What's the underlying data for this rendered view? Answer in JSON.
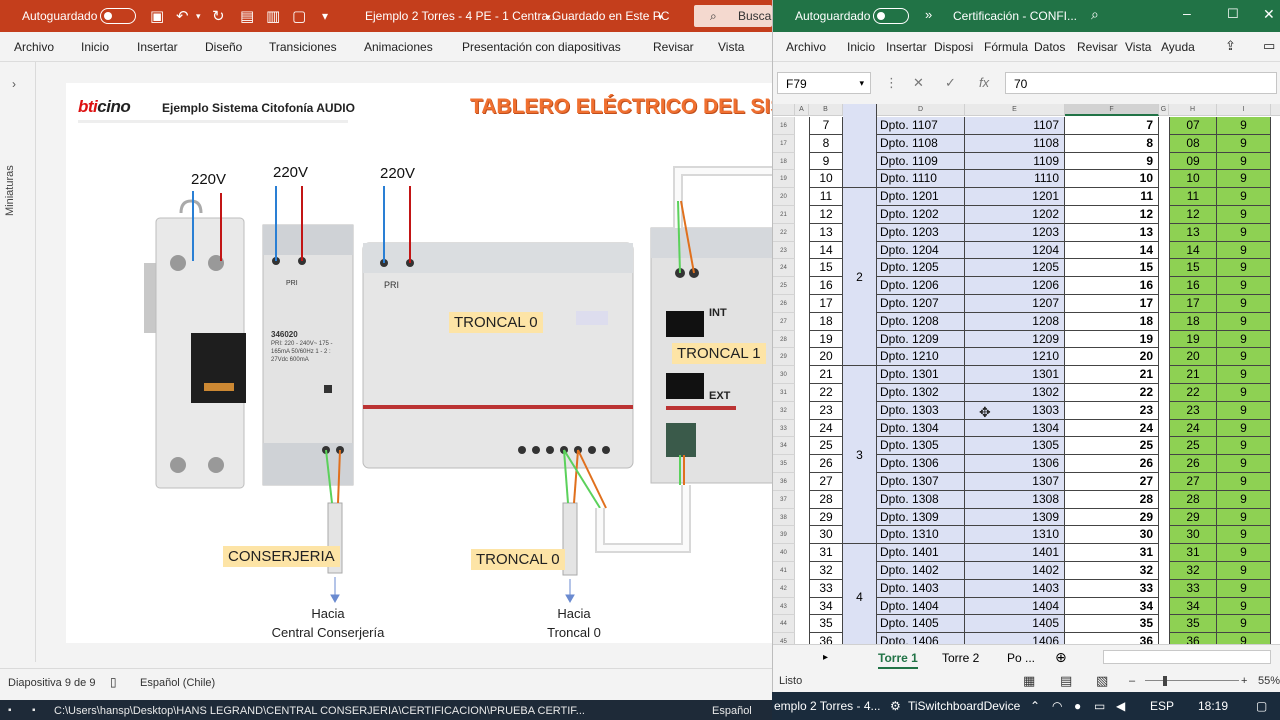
{
  "ppt": {
    "autosave_label": "Autoguardado",
    "doc_title": "Ejemplo 2 Torres - 4 PE - 1 Centra...",
    "save_state": "Guardado en Este PC",
    "search_label": "Buscar",
    "ribbon": [
      "Archivo",
      "Inicio",
      "Insertar",
      "Diseño",
      "Transiciones",
      "Animaciones",
      "Presentación con diapositivas",
      "Revisar",
      "Vista"
    ],
    "thumbs_label": "Miniaturas",
    "status_slide": "Diapositiva 9 de 9",
    "status_lang": "Español (Chile)"
  },
  "slide": {
    "logo_part1": "bti",
    "logo_part2": "cino",
    "subtitle": "Ejemplo Sistema Citofonía AUDIO",
    "title": "TABLERO ELÉCTRICO DEL SISTE",
    "v220": [
      "220V",
      "220V",
      "220V"
    ],
    "psu_model": "346020",
    "psu_text": "PRI: 220 - 240V~ 175 - 165mA 50/60Hz 1 - 2 : 27Vdc 600mA",
    "pri_label": "PRI",
    "int_label": "INT",
    "ext_label": "EXT",
    "troncal0_box": "TRONCAL  0",
    "troncal1_box": "TRONCAL  1",
    "conserjeria_box": "CONSERJERIA",
    "troncal0_bottom": "TRONCAL  0",
    "hacia1_line1": "Hacia",
    "hacia1_line2": "Central Conserjería",
    "hacia2_line1": "Hacia",
    "hacia2_line2": "Troncal  0"
  },
  "xl": {
    "autosave_label": "Autoguardado",
    "doc_title": "Certificación - CONFI...",
    "tabs": [
      "Archivo",
      "Inicio",
      "Insertar",
      "Disposi",
      "Fórmula",
      "Datos",
      "Revisar",
      "Vista",
      "Ayuda"
    ],
    "name_box": "F79",
    "formula_value": "70",
    "columns": [
      "A",
      "B",
      "C",
      "D",
      "E",
      "F",
      "G",
      "H",
      "I"
    ],
    "rows": [
      {
        "r": "16",
        "b": "7",
        "d": "Dpto. 1107",
        "e": "1107",
        "f": "7",
        "h": "07",
        "i": "9"
      },
      {
        "r": "17",
        "b": "8",
        "d": "Dpto. 1108",
        "e": "1108",
        "f": "8",
        "h": "08",
        "i": "9"
      },
      {
        "r": "18",
        "b": "9",
        "d": "Dpto. 1109",
        "e": "1109",
        "f": "9",
        "h": "09",
        "i": "9"
      },
      {
        "r": "19",
        "b": "10",
        "d": "Dpto. 1110",
        "e": "1110",
        "f": "10",
        "h": "10",
        "i": "9"
      },
      {
        "r": "20",
        "b": "11",
        "d": "Dpto. 1201",
        "e": "1201",
        "f": "11",
        "h": "11",
        "i": "9"
      },
      {
        "r": "21",
        "b": "12",
        "d": "Dpto. 1202",
        "e": "1202",
        "f": "12",
        "h": "12",
        "i": "9"
      },
      {
        "r": "22",
        "b": "13",
        "d": "Dpto. 1203",
        "e": "1203",
        "f": "13",
        "h": "13",
        "i": "9"
      },
      {
        "r": "23",
        "b": "14",
        "d": "Dpto. 1204",
        "e": "1204",
        "f": "14",
        "h": "14",
        "i": "9"
      },
      {
        "r": "24",
        "b": "15",
        "d": "Dpto. 1205",
        "e": "1205",
        "f": "15",
        "h": "15",
        "i": "9"
      },
      {
        "r": "25",
        "b": "16",
        "d": "Dpto. 1206",
        "e": "1206",
        "f": "16",
        "h": "16",
        "i": "9"
      },
      {
        "r": "26",
        "b": "17",
        "d": "Dpto. 1207",
        "e": "1207",
        "f": "17",
        "h": "17",
        "i": "9"
      },
      {
        "r": "27",
        "b": "18",
        "d": "Dpto. 1208",
        "e": "1208",
        "f": "18",
        "h": "18",
        "i": "9"
      },
      {
        "r": "28",
        "b": "19",
        "d": "Dpto. 1209",
        "e": "1209",
        "f": "19",
        "h": "19",
        "i": "9"
      },
      {
        "r": "29",
        "b": "20",
        "d": "Dpto. 1210",
        "e": "1210",
        "f": "20",
        "h": "20",
        "i": "9"
      },
      {
        "r": "30",
        "b": "21",
        "d": "Dpto. 1301",
        "e": "1301",
        "f": "21",
        "h": "21",
        "i": "9"
      },
      {
        "r": "31",
        "b": "22",
        "d": "Dpto. 1302",
        "e": "1302",
        "f": "22",
        "h": "22",
        "i": "9"
      },
      {
        "r": "32",
        "b": "23",
        "d": "Dpto. 1303",
        "e": "1303",
        "f": "23",
        "h": "23",
        "i": "9"
      },
      {
        "r": "33",
        "b": "24",
        "d": "Dpto. 1304",
        "e": "1304",
        "f": "24",
        "h": "24",
        "i": "9"
      },
      {
        "r": "34",
        "b": "25",
        "d": "Dpto. 1305",
        "e": "1305",
        "f": "25",
        "h": "25",
        "i": "9"
      },
      {
        "r": "35",
        "b": "26",
        "d": "Dpto. 1306",
        "e": "1306",
        "f": "26",
        "h": "26",
        "i": "9"
      },
      {
        "r": "36",
        "b": "27",
        "d": "Dpto. 1307",
        "e": "1307",
        "f": "27",
        "h": "27",
        "i": "9"
      },
      {
        "r": "37",
        "b": "28",
        "d": "Dpto. 1308",
        "e": "1308",
        "f": "28",
        "h": "28",
        "i": "9"
      },
      {
        "r": "38",
        "b": "29",
        "d": "Dpto. 1309",
        "e": "1309",
        "f": "29",
        "h": "29",
        "i": "9"
      },
      {
        "r": "39",
        "b": "30",
        "d": "Dpto. 1310",
        "e": "1310",
        "f": "30",
        "h": "30",
        "i": "9"
      },
      {
        "r": "40",
        "b": "31",
        "d": "Dpto. 1401",
        "e": "1401",
        "f": "31",
        "h": "31",
        "i": "9"
      },
      {
        "r": "41",
        "b": "32",
        "d": "Dpto. 1402",
        "e": "1402",
        "f": "32",
        "h": "32",
        "i": "9"
      },
      {
        "r": "42",
        "b": "33",
        "d": "Dpto. 1403",
        "e": "1403",
        "f": "33",
        "h": "33",
        "i": "9"
      },
      {
        "r": "43",
        "b": "34",
        "d": "Dpto. 1404",
        "e": "1404",
        "f": "34",
        "h": "34",
        "i": "9"
      },
      {
        "r": "44",
        "b": "35",
        "d": "Dpto. 1405",
        "e": "1405",
        "f": "35",
        "h": "35",
        "i": "9"
      },
      {
        "r": "45",
        "b": "36",
        "d": "Dpto. 1406",
        "e": "1406",
        "f": "36",
        "h": "36",
        "i": "9"
      }
    ],
    "groups": [
      {
        "label": "2",
        "first_row": 4,
        "span": 10
      },
      {
        "label": "3",
        "first_row": 14,
        "span": 10
      },
      {
        "label": "4",
        "first_row": 24,
        "span": 6
      }
    ],
    "sheet_tabs": [
      "Torre 1",
      "Torre 2",
      "Po ..."
    ],
    "status_ready": "Listo",
    "zoom": "55%"
  },
  "taskbar": {
    "left_path": "C:\\Users\\hansp\\Desktop\\HANS LEGRAND\\CENTRAL CONSERJERIA\\CERTIFICACION\\PRUEBA CERTIF...",
    "left_lang": "Español",
    "app1": "emplo 2 Torres - 4...",
    "app2": "TiSwitchboardDevice",
    "lang": "ESP",
    "time": "18:19"
  },
  "colors": {
    "ppt_accent": "#c43e1c",
    "xl_accent": "#217346",
    "band_blue": "#dce1f4",
    "band_green": "#8ed153",
    "label_yellow": "#fde4a6"
  }
}
